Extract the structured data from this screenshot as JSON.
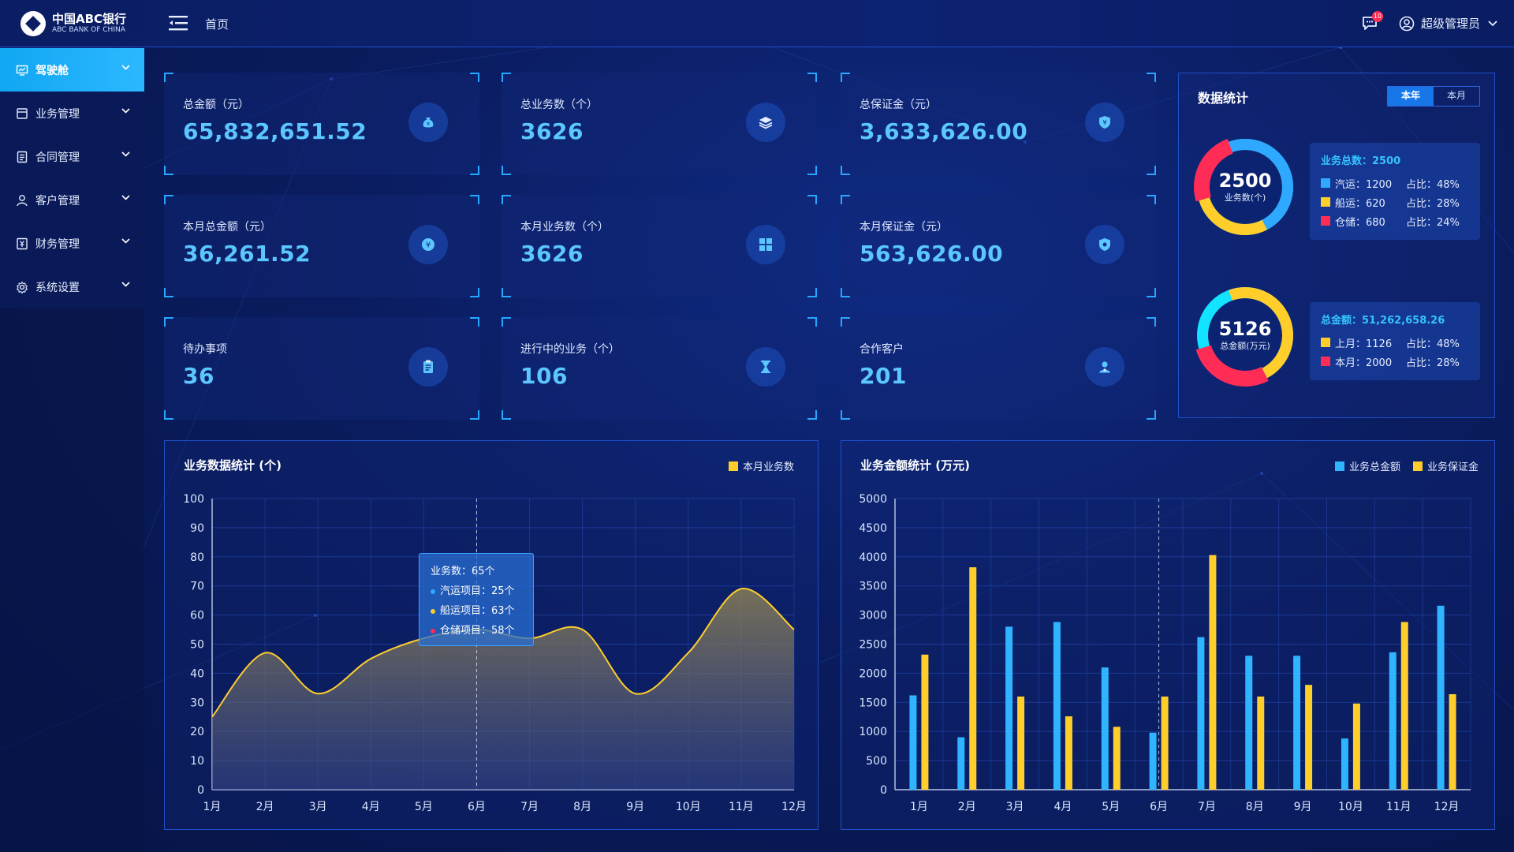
{
  "brand": {
    "name_cn": "中国ABC银行",
    "name_en": "ABC BANK OF CHINA"
  },
  "topbar": {
    "home": "首页",
    "notification_count": "10",
    "user_name": "超级管理员"
  },
  "sidebar": {
    "items": [
      {
        "label": "驾驶舱",
        "icon": "dashboard-icon",
        "active": true
      },
      {
        "label": "业务管理",
        "icon": "business-icon"
      },
      {
        "label": "合同管理",
        "icon": "contract-icon"
      },
      {
        "label": "客户管理",
        "icon": "customer-icon"
      },
      {
        "label": "财务管理",
        "icon": "finance-icon"
      },
      {
        "label": "系统设置",
        "icon": "settings-icon"
      }
    ]
  },
  "cards": [
    {
      "label": "总金额（元）",
      "value": "65,832,651.52",
      "icon": "money-bag-icon"
    },
    {
      "label": "总业务数（个）",
      "value": "3626",
      "icon": "layers-icon"
    },
    {
      "label": "总保证金（元）",
      "value": "3,633,626.00",
      "icon": "shield-yuan-icon"
    },
    {
      "label": "本月总金额（元）",
      "value": "36,261.52",
      "icon": "yuan-coin-icon"
    },
    {
      "label": "本月业务数（个）",
      "value": "3626",
      "icon": "grid-icon"
    },
    {
      "label": "本月保证金（元）",
      "value": "563,626.00",
      "icon": "shield-icon"
    },
    {
      "label": "待办事项",
      "value": "36",
      "icon": "clipboard-icon"
    },
    {
      "label": "进行中的业务（个）",
      "value": "106",
      "icon": "hourglass-icon"
    },
    {
      "label": "合作客户",
      "value": "201",
      "icon": "user-icon"
    }
  ],
  "stats": {
    "title": "数据统计",
    "tabs": [
      "本年",
      "本月"
    ],
    "active_tab": "本年",
    "donut1": {
      "center_value": "2500",
      "center_label": "业务数(个)",
      "head": "业务总数：2500",
      "rows": [
        {
          "name": "汽运：1200",
          "pct": "占比：48%",
          "color": "#2fa8ff",
          "share": 0.48
        },
        {
          "name": "船运：620",
          "pct": "占比：28%",
          "color": "#ffce2b",
          "share": 0.28
        },
        {
          "name": "仓储：680",
          "pct": "占比：24%",
          "color": "#ff2d55",
          "share": 0.24
        }
      ]
    },
    "donut2": {
      "center_value": "5126",
      "center_label": "总金额(万元)",
      "head": "总金额：51,262,658.26",
      "rows": [
        {
          "name": "上月：1126",
          "pct": "占比：48%",
          "color": "#ffce2b",
          "share": 0.48
        },
        {
          "name": "本月：2000",
          "pct": "占比：28%",
          "color": "#ff2d55",
          "share": 0.28
        }
      ]
    }
  },
  "chart_data": [
    {
      "type": "area",
      "title": "业务数据统计 (个)",
      "x": [
        "1月",
        "2月",
        "3月",
        "4月",
        "5月",
        "6月",
        "7月",
        "8月",
        "9月",
        "10月",
        "11月",
        "12月"
      ],
      "series": [
        {
          "name": "本月业务数",
          "values": [
            25,
            47,
            33,
            45,
            52,
            55,
            52,
            55,
            33,
            47,
            69,
            55
          ],
          "color": "#ffce2b"
        }
      ],
      "ylim": [
        0,
        100
      ],
      "yticks": [
        0,
        10,
        20,
        30,
        40,
        50,
        60,
        70,
        80,
        90,
        100
      ],
      "tooltip": {
        "category": "6月",
        "lines": [
          "业务数：65个",
          "汽运项目：25个",
          "船运项目：63个",
          "仓储项目：58个"
        ],
        "dot_colors": [
          "",
          "#2fa8ff",
          "#ffce2b",
          "#ff2d55"
        ]
      }
    },
    {
      "type": "bar",
      "title": "业务金额统计 (万元)",
      "x": [
        "1月",
        "2月",
        "3月",
        "4月",
        "5月",
        "6月",
        "7月",
        "8月",
        "9月",
        "10月",
        "11月",
        "12月"
      ],
      "series": [
        {
          "name": "业务总金额",
          "values": [
            1620,
            900,
            2800,
            2880,
            2100,
            980,
            2620,
            2300,
            2300,
            880,
            2360,
            3160
          ],
          "color": "#2fb4ff"
        },
        {
          "name": "业务保证金",
          "values": [
            2320,
            3820,
            1600,
            1260,
            1080,
            1600,
            4030,
            1600,
            1800,
            1480,
            2880,
            1640
          ],
          "color": "#ffce2b"
        }
      ],
      "ylim": [
        0,
        5000
      ],
      "yticks": [
        0,
        500,
        1000,
        1500,
        2000,
        2500,
        3000,
        3500,
        4000,
        4500,
        5000
      ],
      "highlight_category": "6月"
    }
  ]
}
